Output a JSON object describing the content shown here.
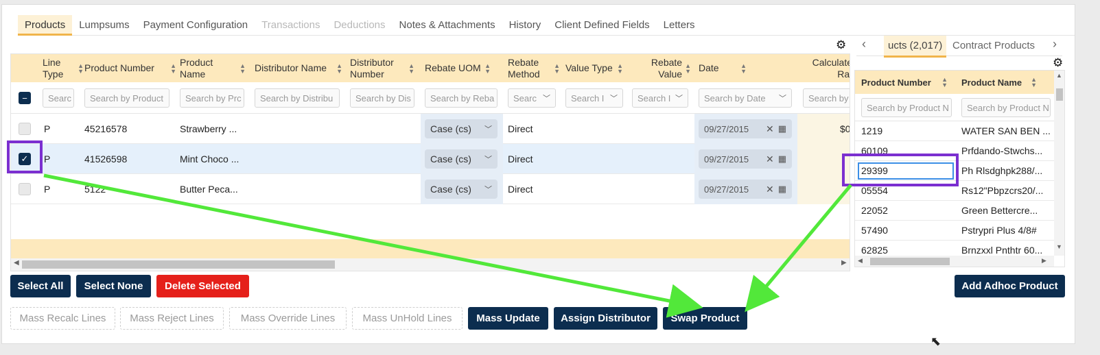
{
  "tabs": [
    {
      "label": "Products",
      "state": "active"
    },
    {
      "label": "Lumpsums",
      "state": "normal"
    },
    {
      "label": "Payment Configuration",
      "state": "normal"
    },
    {
      "label": "Transactions",
      "state": "disabled"
    },
    {
      "label": "Deductions",
      "state": "disabled"
    },
    {
      "label": "Notes & Attachments",
      "state": "normal"
    },
    {
      "label": "History",
      "state": "normal"
    },
    {
      "label": "Client Defined Fields",
      "state": "normal"
    },
    {
      "label": "Letters",
      "state": "normal"
    }
  ],
  "grid": {
    "columns": {
      "line_type": "Line Type",
      "product_number": "Product Number",
      "product_name": "Product Name",
      "distributor_name": "Distributor Name",
      "distributor_number": "Distributor Number",
      "rebate_uom": "Rebate UOM",
      "rebate_method": "Rebate Method",
      "value_type": "Value Type",
      "rebate_value": "Rebate Value",
      "date": "Date",
      "calculated_rate": "Calculate Rat"
    },
    "filters": {
      "line_type": "Searc",
      "product_number": "Search by Product",
      "product_name": "Search by Prc",
      "distributor_name": "Search by Distribu",
      "distributor_number": "Search by Dis",
      "rebate_uom": "Search by Reba",
      "rebate_method": "Searc",
      "value_type": "Search I",
      "rebate_value": "Search I",
      "date": "Search by Date",
      "calculated_rate": "Search by"
    },
    "rows": [
      {
        "line_type": "P",
        "product_number": "45216578",
        "product_name": "Strawberry ...",
        "rebate_uom": "Case (cs)",
        "rebate_method": "Direct",
        "date": "09/27/2015",
        "calc": "$0",
        "selected": false
      },
      {
        "line_type": "P",
        "product_number": "41526598",
        "product_name": "Mint Choco ...",
        "rebate_uom": "Case (cs)",
        "rebate_method": "Direct",
        "date": "09/27/2015",
        "calc": "",
        "selected": true
      },
      {
        "line_type": "P",
        "product_number": "5122",
        "product_name": "Butter Peca...",
        "rebate_uom": "Case (cs)",
        "rebate_method": "Direct",
        "date": "09/27/2015",
        "calc": "",
        "selected": false
      }
    ]
  },
  "buttons_row1": {
    "select_all": "Select All",
    "select_none": "Select None",
    "delete_selected": "Delete Selected"
  },
  "buttons_row2": {
    "mass_recalc": "Mass Recalc Lines",
    "mass_reject": "Mass Reject Lines",
    "mass_override": "Mass Override Lines",
    "mass_unhold": "Mass UnHold Lines",
    "mass_update": "Mass Update",
    "assign_distributor": "Assign Distributor",
    "swap_product": "Swap Product"
  },
  "right_panel": {
    "tabs": [
      {
        "label": "ucts (2,017)",
        "state": "active"
      },
      {
        "label": "Contract Products",
        "state": "normal"
      }
    ],
    "columns": {
      "product_number": "Product Number",
      "product_name": "Product Name"
    },
    "filters": {
      "product_number": "Search by Product N",
      "product_name": "Search by Product N"
    },
    "rows": [
      {
        "number": "1219",
        "name": "WATER SAN BEN ..."
      },
      {
        "number": "60109",
        "name": "Prfdando-Stwchs..."
      },
      {
        "number": "29399",
        "name": "Ph Rlsdghpk288/..."
      },
      {
        "number": "05554",
        "name": "Rs12\"Pbpzcrs20/..."
      },
      {
        "number": "22052",
        "name": "Green Bettercre..."
      },
      {
        "number": "57490",
        "name": "Pstrypri Plus 4/8#"
      },
      {
        "number": "62825",
        "name": "Brnzxxl Pnthtr 60..."
      }
    ],
    "add_adhoc": "Add Adhoc Product"
  },
  "annotation_colors": {
    "highlight": "#7b2fd0",
    "arrow": "#52e83a"
  },
  "icons": {
    "settings": "gear-icon",
    "sort": "sort-icon",
    "clear": "close-icon",
    "calendar": "calendar-icon",
    "dropdown": "chevron-down-icon"
  }
}
